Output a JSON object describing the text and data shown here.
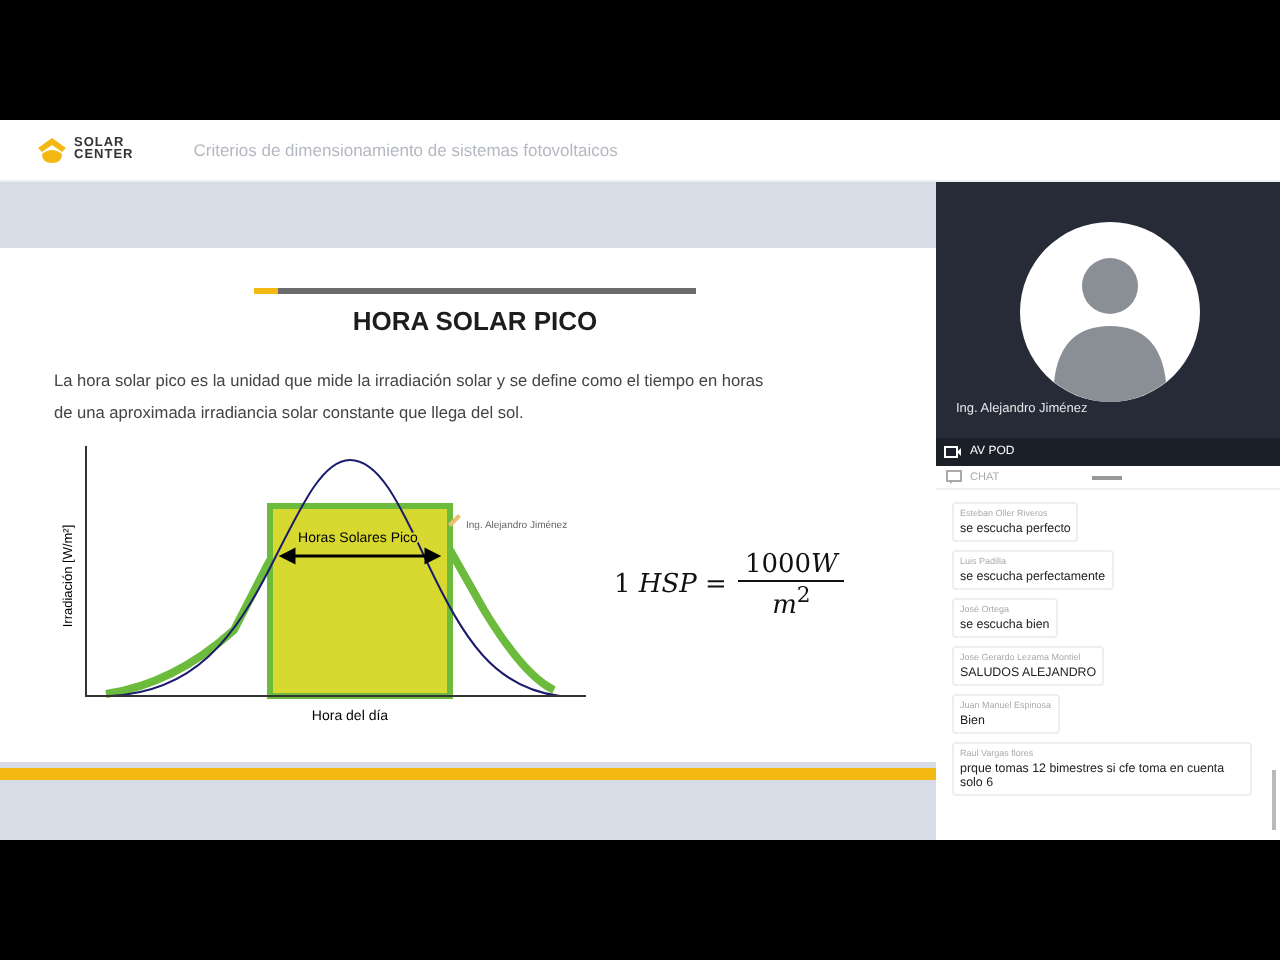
{
  "header": {
    "logo_line1": "SOLAR",
    "logo_line2": "CENTER",
    "title": "Criterios de dimensionamiento de sistemas fotovoltaicos"
  },
  "slide": {
    "title": "HORA SOLAR PICO",
    "paragraph": "La hora solar pico es la unidad que mide la irradiación solar y se define como el tiempo en horas de una aproximada irradiancia solar constante que llega del sol.",
    "chart": {
      "ylabel": "Irradiación [W/m²]",
      "xlabel": "Hora del día",
      "band_label": "Horas Solares Pico",
      "annotation": "Ing. Alejandro Jiménez"
    },
    "equation": {
      "lhs": "1 *HSP* =",
      "numerator": "1000",
      "numerator_unit": "W",
      "denominator": "*m*$^{2}$"
    }
  },
  "video": {
    "presenter": "Ing. Alejandro Jiménez",
    "pod_label": "AV POD"
  },
  "chat": {
    "title": "CHAT",
    "messages": [
      {
        "author": "Esteban Oller Riveros",
        "text": "se escucha perfecto"
      },
      {
        "author": "Luis Padilla",
        "text": "se escucha perfectamente"
      },
      {
        "author": "José Ortega",
        "text": "se escucha bien"
      },
      {
        "author": "Jose Gerardo Lezama Montiel",
        "text": "SALUDOS ALEJANDRO"
      },
      {
        "author": "Juan Manuel Espinosa",
        "text": "Bien"
      },
      {
        "author": "Raul Vargas flores",
        "text": "prque tomas 12 bimestres si cfe toma en cuenta solo 6"
      }
    ]
  }
}
